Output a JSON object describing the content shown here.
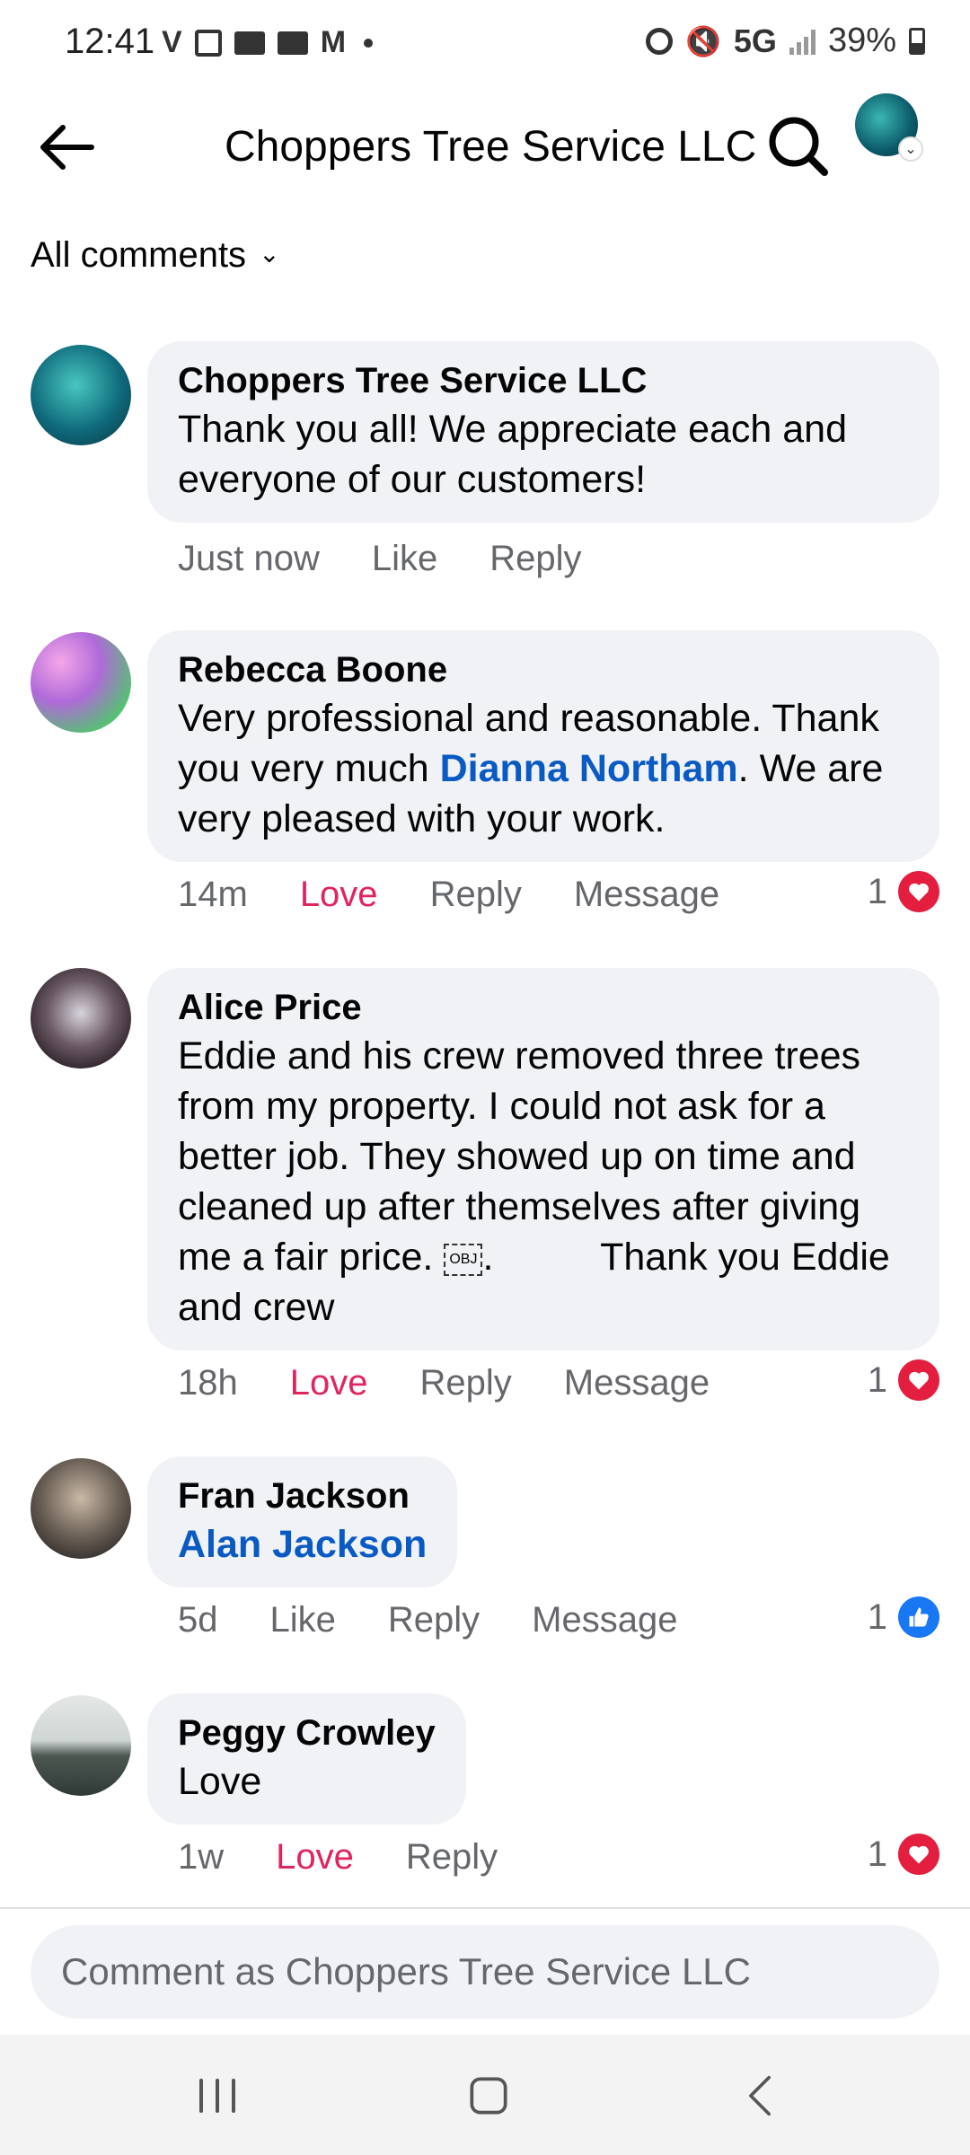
{
  "status_bar": {
    "time": "12:41",
    "carrier_icon": "V",
    "network": "5G",
    "battery": "39%"
  },
  "header": {
    "title": "Choppers Tree Service LLC",
    "back_icon": "arrow-left-icon",
    "search_icon": "search-icon"
  },
  "filter": {
    "label": "All comments"
  },
  "comments": [
    {
      "author": "Choppers Tree Service LLC",
      "text": "Thank you all! We appreciate each and everyone of our customers!",
      "time": "Just now",
      "reaction_label": "Like",
      "reply_label": "Reply"
    },
    {
      "author": "Rebecca Boone",
      "text_before": "Very professional and reasonable. Thank you very much ",
      "mention": "Dianna Northam",
      "text_after": ". We are very pleased with your work.",
      "time": "14m",
      "reaction_label": "Love",
      "reply_label": "Reply",
      "message_label": "Message",
      "reaction_count": "1"
    },
    {
      "author": "Alice Price",
      "text_before": "Eddie and his crew removed three trees from my property. I could not ask for a better job. They showed up on time and cleaned up after themselves after giving me a fair price. ",
      "obj": "OBJ",
      "text_after": ".          Thank you Eddie and crew",
      "time": "18h",
      "reaction_label": "Love",
      "reply_label": "Reply",
      "message_label": "Message",
      "reaction_count": "1"
    },
    {
      "author": "Fran Jackson",
      "mention": "Alan Jackson",
      "time": "5d",
      "reaction_label": "Like",
      "reply_label": "Reply",
      "message_label": "Message",
      "reaction_count": "1"
    },
    {
      "author": "Peggy Crowley",
      "text": "Love",
      "time": "1w",
      "reaction_label": "Love",
      "reply_label": "Reply",
      "reaction_count": "1"
    }
  ],
  "composer": {
    "placeholder": "Comment as Choppers Tree Service LLC"
  },
  "colors": {
    "love": "#e0245e",
    "link": "#0a5ac4",
    "bubble": "#f0f2f5",
    "meta": "#65676b"
  }
}
